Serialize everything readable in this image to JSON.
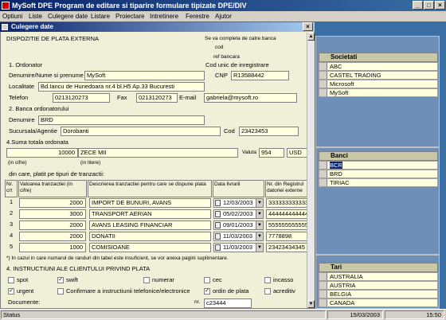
{
  "app": {
    "title": "MySoft DPE Program de editare si tiparire formulare tipizate DPE/DIV",
    "minimize": "_",
    "maximize": "□",
    "close": "×"
  },
  "menu": [
    "Optiuni",
    "Liste",
    "Culegere date",
    "Listare",
    "Proiectare",
    "Intretinere",
    "Ferestre",
    "Ajutor"
  ],
  "child": {
    "title": "Culegere date",
    "close": "×"
  },
  "form": {
    "heading": "DISPOZITIE DE PLATA EXTERNA",
    "completion_note": "Se va completa de catre banca",
    "cod_label": "cod",
    "ref_label": "ref bancara",
    "unique_code_label": "Cod unic de inregistrare",
    "ordonator_label": "1. Ordonator",
    "name_label": "Denumire/Nume si prenume",
    "name_value": "MySoft",
    "cnp_label": "CNP",
    "cnp_value": "R13588442",
    "address_label": "Localitate",
    "address_value": "Bd.Iancu de Hunedoara nr.4 bl.H5 Ap.33 Bucuresti",
    "phone_label": "Telefon",
    "phone_value": "0213120273",
    "fax_label": "Fax",
    "fax_value": "0213120273",
    "email_label": "E-mail",
    "email_value": "gabriela@mysoft.ro",
    "bank_label": "2. Banca ordonatorului",
    "bank_name_label": "Denumire",
    "bank_name_value": "BRD",
    "branch_label": "Sucursala/Agentie",
    "branch_value": "Dorobanti",
    "branch_code_label": "Cod",
    "branch_code_value": "23423453",
    "total_label": "4.Suma totala ordonata",
    "total_amount": "10000",
    "total_words": "ZECE MII",
    "currency_label": "Valuta",
    "currency_code": "954",
    "currency_value": "USD",
    "in_figures": "(in cifre)",
    "in_letters": "(in litere)",
    "breakdown_label": "din care, platit pe tipuri de tranzactii:",
    "table_headers": {
      "nr": "Nr. crt",
      "value": "Valoarea tranzactiei (in cifre)",
      "description": "Descrierea tranzactiei pentru care se dispune plata",
      "date": "Data livrarii",
      "register": "Nr. din Registrul datoriei externe"
    },
    "rows": [
      {
        "nr": "1",
        "value": "2000",
        "desc": "IMPORT DE BUNURI, AVANS",
        "date": "12/03/2003",
        "reg": "333333333333"
      },
      {
        "nr": "2",
        "value": "3000",
        "desc": "TRANSPORT AERIAN",
        "date": "05/02/2003",
        "reg": "444444444444"
      },
      {
        "nr": "3",
        "value": "2000",
        "desc": "AVANS LEASING FINANCIAR",
        "date": "09/01/2003",
        "reg": "555555555555"
      },
      {
        "nr": "4",
        "value": "2000",
        "desc": "DONATII",
        "date": "11/03/2003",
        "reg": "7778898"
      },
      {
        "nr": "5",
        "value": "1000",
        "desc": "COMISIOANE",
        "date": "11/03/2003",
        "reg": "23423434345"
      }
    ],
    "footnote": "*) In cazul in care numarul de randuri din tabel este insuficient, se vor anexa pagini suplimentare.",
    "instructions_label": "4. INSTRUCTIUNI ALE CLIENTULUI PRIVIND PLATA",
    "options": [
      {
        "label": "spot",
        "checked": false
      },
      {
        "label": "swift",
        "checked": true
      },
      {
        "label": "numerar",
        "checked": false
      },
      {
        "label": "cec",
        "checked": false
      },
      {
        "label": "incasso",
        "checked": false
      },
      {
        "label": "urgent",
        "checked": true
      },
      {
        "label": "Confirmare a instructiunii telefonice/electronice",
        "checked": false
      },
      {
        "label": "ordin de plata",
        "checked": true
      },
      {
        "label": "acreditiv",
        "checked": false
      }
    ],
    "check_mark": "✓",
    "documents_label": "Documente:",
    "nr_label": "nr.",
    "nr_value": "c23444"
  },
  "societati": {
    "title": "Societati",
    "items": [
      "ABC",
      "CASTEL TRADING",
      "Microsoft",
      "MySoft"
    ]
  },
  "banci": {
    "title": "Banci",
    "items": [
      "BCR",
      "BRD",
      "TIRIAC"
    ],
    "selected": 0
  },
  "tari": {
    "title": "Tari",
    "items": [
      "AUSTRALIA",
      "AUSTRIA",
      "BELGIA",
      "CANADA"
    ]
  },
  "status": {
    "text": "Status",
    "date": "15/03/2003",
    "time": "15:50"
  },
  "scroll": {
    "up": "▲",
    "down": "▼",
    "drop": "▼"
  }
}
